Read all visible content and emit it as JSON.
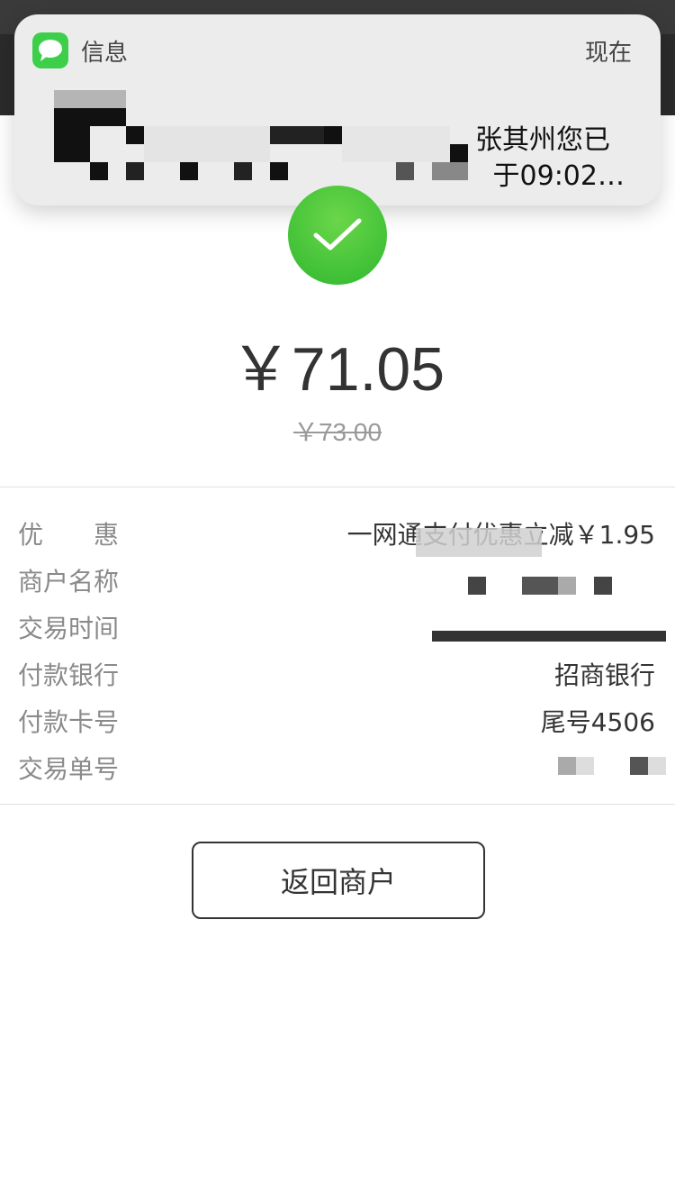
{
  "notification": {
    "app_name": "信息",
    "time": "现在",
    "line1": "张其州您已",
    "line2": "于09:02…"
  },
  "payment": {
    "amount": "￥71.05",
    "original_amount": "￥73.00"
  },
  "details": [
    {
      "label": "优　　惠",
      "value": "一网通支付优惠立减￥1.95"
    },
    {
      "label": "商户名称",
      "value": ""
    },
    {
      "label": "交易时间",
      "value": ""
    },
    {
      "label": "付款银行",
      "value": "招商银行"
    },
    {
      "label": "付款卡号",
      "value": "尾号4506"
    },
    {
      "label": "交易单号",
      "value": ""
    }
  ],
  "actions": {
    "return_label": "返回商户"
  },
  "colors": {
    "success_green": "#2fb82f",
    "notification_bg": "#ececec",
    "label_gray": "#8a8a8a"
  },
  "icons": {
    "app_icon": "messages-icon",
    "status_icon": "checkmark-icon"
  }
}
